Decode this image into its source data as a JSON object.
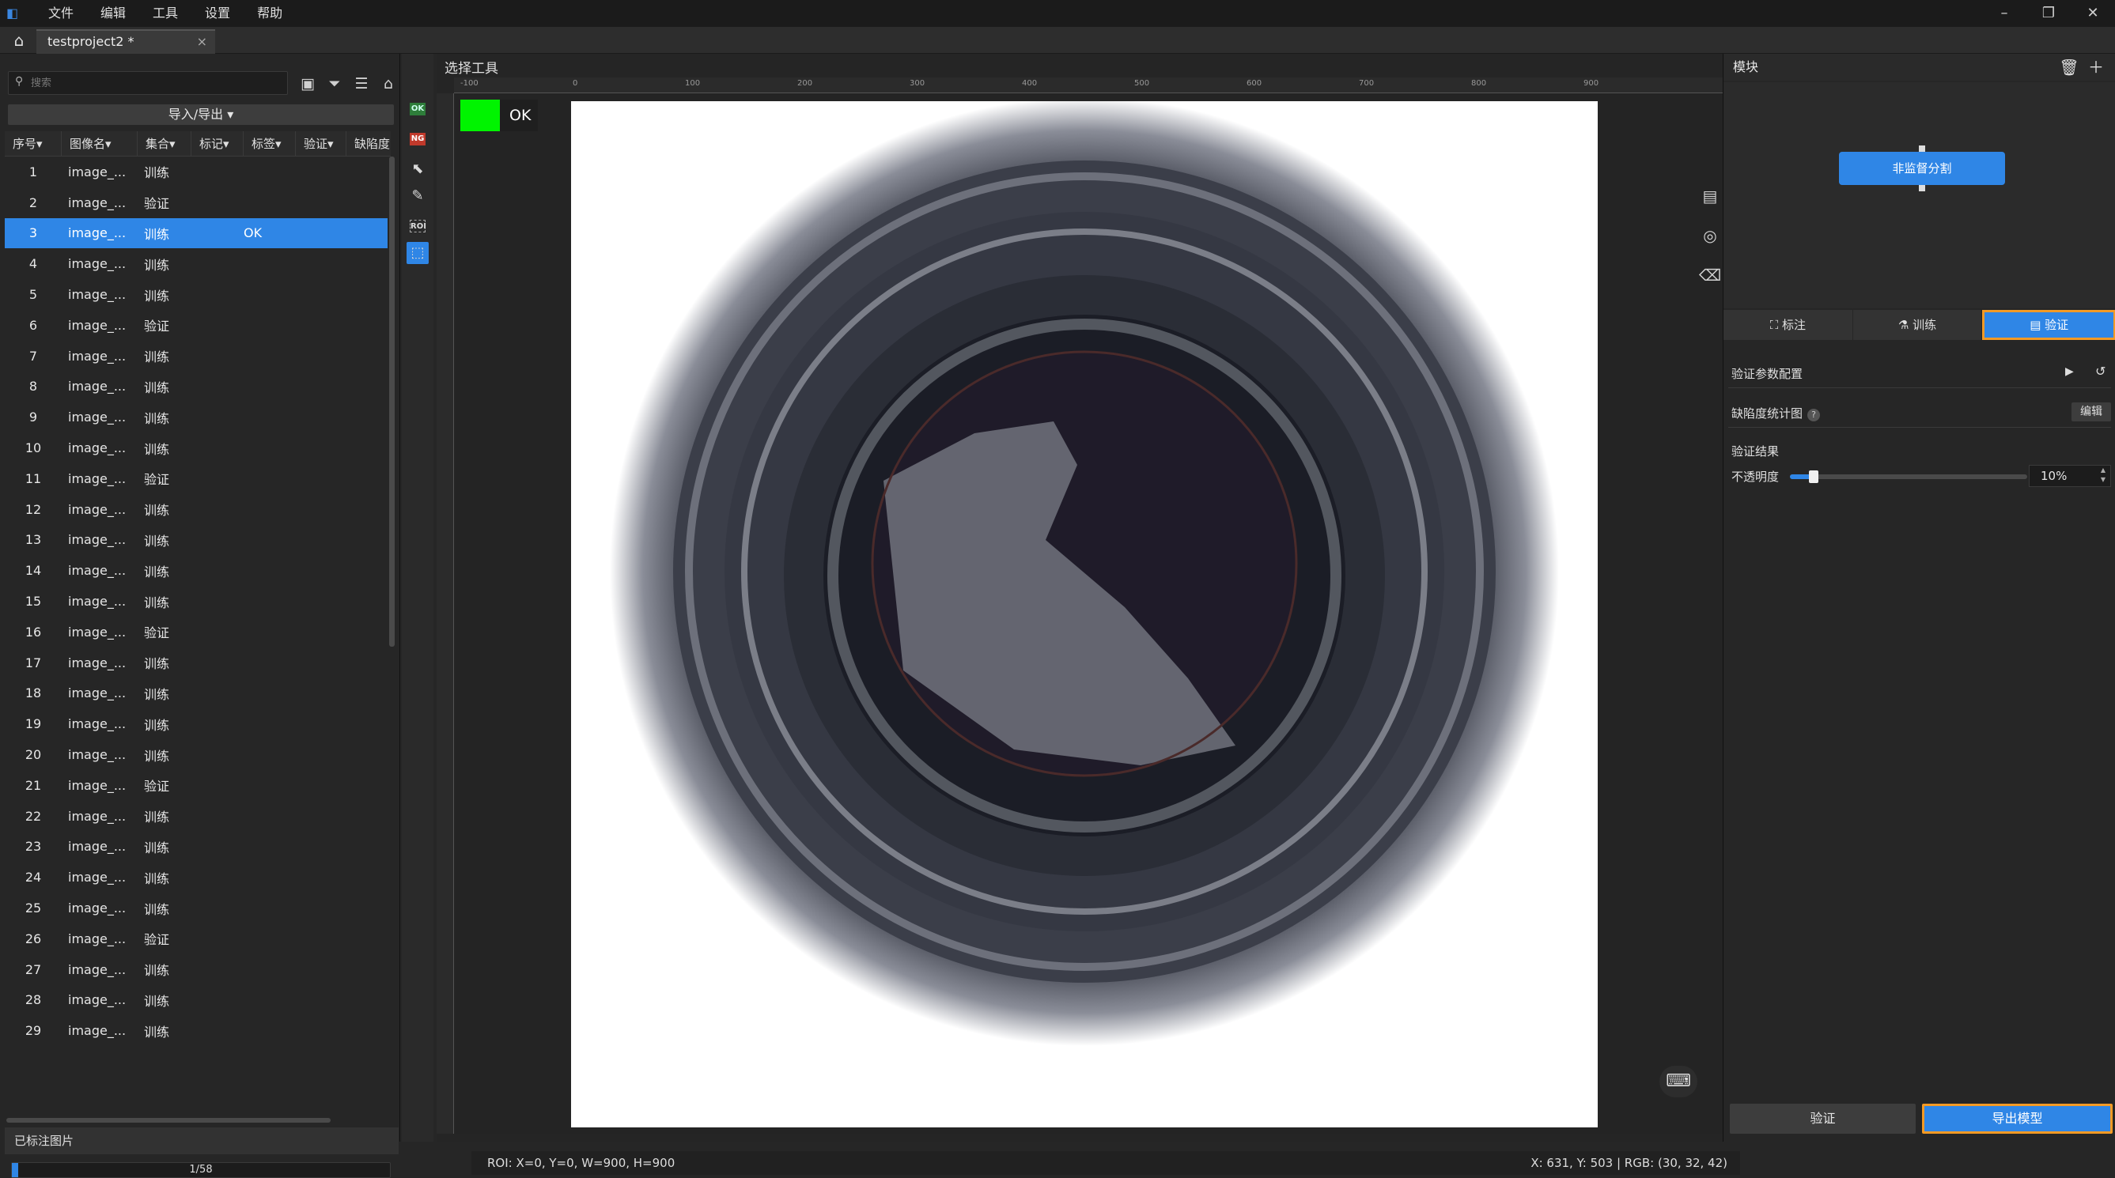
{
  "menu": [
    "文件",
    "编辑",
    "工具",
    "设置",
    "帮助"
  ],
  "window_controls": [
    "–",
    "❐",
    "✕"
  ],
  "project_tab": {
    "name": "testproject2 *",
    "close": "×"
  },
  "left": {
    "search_placeholder": "搜索",
    "import_export": "导入/导出 ▾",
    "columns": [
      "序号▾",
      "图像名▾",
      "集合▾",
      "标记▾",
      "标签▾",
      "验证▾",
      "缺陷度"
    ],
    "rows": [
      {
        "idx": "1",
        "name": "image_...",
        "set": "训练",
        "verify": ""
      },
      {
        "idx": "2",
        "name": "image_...",
        "set": "验证",
        "verify": ""
      },
      {
        "idx": "3",
        "name": "image_...",
        "set": "训练",
        "verify": "OK"
      },
      {
        "idx": "4",
        "name": "image_...",
        "set": "训练",
        "verify": ""
      },
      {
        "idx": "5",
        "name": "image_...",
        "set": "训练",
        "verify": ""
      },
      {
        "idx": "6",
        "name": "image_...",
        "set": "验证",
        "verify": ""
      },
      {
        "idx": "7",
        "name": "image_...",
        "set": "训练",
        "verify": ""
      },
      {
        "idx": "8",
        "name": "image_...",
        "set": "训练",
        "verify": ""
      },
      {
        "idx": "9",
        "name": "image_...",
        "set": "训练",
        "verify": ""
      },
      {
        "idx": "10",
        "name": "image_...",
        "set": "训练",
        "verify": ""
      },
      {
        "idx": "11",
        "name": "image_...",
        "set": "验证",
        "verify": ""
      },
      {
        "idx": "12",
        "name": "image_...",
        "set": "训练",
        "verify": ""
      },
      {
        "idx": "13",
        "name": "image_...",
        "set": "训练",
        "verify": ""
      },
      {
        "idx": "14",
        "name": "image_...",
        "set": "训练",
        "verify": ""
      },
      {
        "idx": "15",
        "name": "image_...",
        "set": "训练",
        "verify": ""
      },
      {
        "idx": "16",
        "name": "image_...",
        "set": "验证",
        "verify": ""
      },
      {
        "idx": "17",
        "name": "image_...",
        "set": "训练",
        "verify": ""
      },
      {
        "idx": "18",
        "name": "image_...",
        "set": "训练",
        "verify": ""
      },
      {
        "idx": "19",
        "name": "image_...",
        "set": "训练",
        "verify": ""
      },
      {
        "idx": "20",
        "name": "image_...",
        "set": "训练",
        "verify": ""
      },
      {
        "idx": "21",
        "name": "image_...",
        "set": "验证",
        "verify": ""
      },
      {
        "idx": "22",
        "name": "image_...",
        "set": "训练",
        "verify": ""
      },
      {
        "idx": "23",
        "name": "image_...",
        "set": "训练",
        "verify": ""
      },
      {
        "idx": "24",
        "name": "image_...",
        "set": "训练",
        "verify": ""
      },
      {
        "idx": "25",
        "name": "image_...",
        "set": "训练",
        "verify": ""
      },
      {
        "idx": "26",
        "name": "image_...",
        "set": "验证",
        "verify": ""
      },
      {
        "idx": "27",
        "name": "image_...",
        "set": "训练",
        "verify": ""
      },
      {
        "idx": "28",
        "name": "image_...",
        "set": "训练",
        "verify": ""
      },
      {
        "idx": "29",
        "name": "image_...",
        "set": "训练",
        "verify": ""
      }
    ],
    "selected_row": 2,
    "labeled_title": "已标注图片",
    "progress_text": "1/58",
    "progress_fraction": 0.017
  },
  "vtools": {
    "ok": "OK",
    "ng": "NG",
    "roi": "ROI"
  },
  "canvas": {
    "select_tool": "选择工具",
    "ruler_labels": [
      "-100",
      "0",
      "100",
      "200",
      "300",
      "400",
      "500",
      "600",
      "700",
      "800",
      "900"
    ],
    "ok_label": "OK",
    "status_left": "ROI: X=0, Y=0, W=900, H=900",
    "status_right": "X: 631, Y: 503 | RGB: (30, 32, 42)"
  },
  "right": {
    "title": "模块",
    "node": "非监督分割",
    "tabs": [
      "标注",
      "训练",
      "验证"
    ],
    "active_tab": 2,
    "verify_params": "验证参数配置",
    "defect_chart": "缺陷度统计图",
    "edit": "编辑",
    "verify_result": "验证结果",
    "opacity_label": "不透明度",
    "opacity_value": "10%",
    "opacity_fraction": 0.1,
    "btn_verify": "验证",
    "btn_export": "导出模型"
  },
  "colors": {
    "accent": "#2f86e6",
    "highlight": "#f39a25",
    "ok_green": "#00f400"
  }
}
